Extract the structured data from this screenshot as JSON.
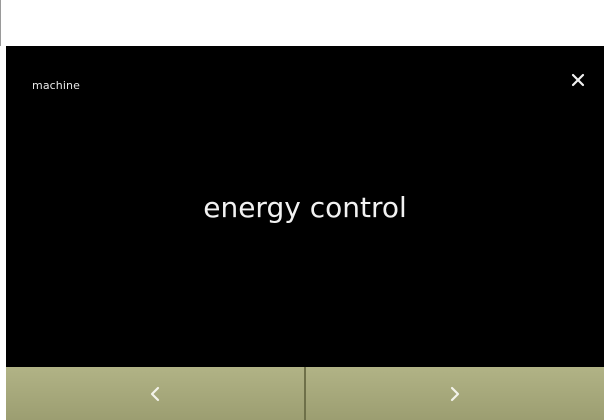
{
  "breadcrumb": "machine",
  "title": "energy control",
  "icons": {
    "close": "close-icon",
    "previous": "chevron-left-icon",
    "next": "chevron-right-icon"
  },
  "colors": {
    "screen_background": "#000000",
    "nav_bar": "#a4a67a",
    "text": "#f2f2f2"
  }
}
